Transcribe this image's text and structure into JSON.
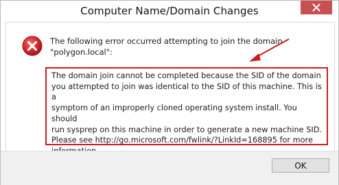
{
  "window": {
    "title": "Computer Name/Domain Changes"
  },
  "titlebar": {
    "close_icon": "close-icon"
  },
  "message": {
    "icon": "error-icon",
    "intro_line1": "The following error occurred attempting to join the domain",
    "intro_line2": "\"polygon.local\":",
    "detail_lines": [
      "The domain join cannot be completed because the SID of the domain",
      "you attempted to join was identical to the SID of this machine. This is a",
      "symptom of an improperly cloned operating system install.  You should",
      "run sysprep on this machine in order to generate a new machine SID.",
      "Please see http://go.microsoft.com/fwlink/?LinkId=168895 for more",
      "information."
    ]
  },
  "annotation": {
    "color": "#cc1b1b"
  },
  "footer": {
    "ok_label": "OK"
  }
}
